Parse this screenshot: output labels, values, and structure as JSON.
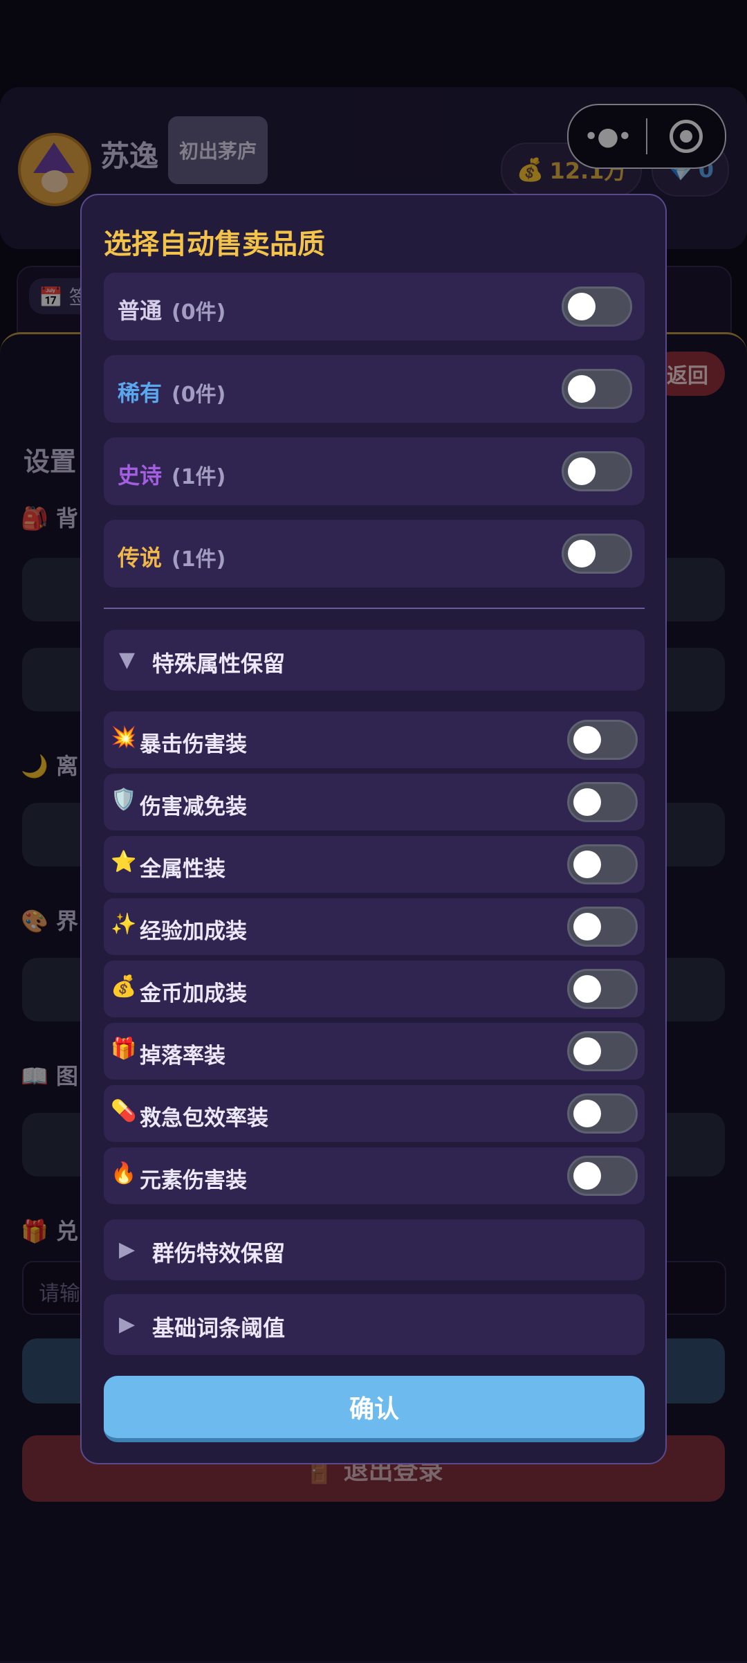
{
  "background": {
    "player_name": "苏逸",
    "rank_badge": "初出茅庐",
    "gold_amount": "12.1万",
    "gem_amount": "0",
    "calendar_chip": "📅 签",
    "back_label": "返回",
    "settings_title": "设置",
    "sections": [
      "🎒 背",
      "🌙 离",
      "🎨 界",
      "📖 图",
      "🎁 兑"
    ],
    "redeem_placeholder": "请输入...",
    "logout_label": "🚪 退出登录"
  },
  "modal": {
    "title": "选择自动售卖品质",
    "qualities": [
      {
        "name": "普通",
        "count": "(0件)",
        "color": "#d6d0ea",
        "enabled": false
      },
      {
        "name": "稀有",
        "count": "(0件)",
        "color": "#5aa7ee",
        "enabled": false
      },
      {
        "name": "史诗",
        "count": "(1件)",
        "color": "#a35fe0",
        "enabled": false
      },
      {
        "name": "传说",
        "count": "(1件)",
        "color": "#f0b84a",
        "enabled": false
      }
    ],
    "special_section": {
      "label": "特殊属性保留",
      "expanded": true
    },
    "attributes": [
      {
        "icon": "💥",
        "icon_name": "explosion-icon",
        "label": "暴击伤害装",
        "enabled": false
      },
      {
        "icon": "🛡️",
        "icon_name": "shield-icon",
        "label": "伤害减免装",
        "enabled": false
      },
      {
        "icon": "⭐",
        "icon_name": "star-icon",
        "label": "全属性装",
        "enabled": false
      },
      {
        "icon": "✨",
        "icon_name": "sparkles-icon",
        "label": "经验加成装",
        "enabled": false
      },
      {
        "icon": "💰",
        "icon_name": "money-bag-icon",
        "label": "金币加成装",
        "enabled": false
      },
      {
        "icon": "🎁",
        "icon_name": "gift-icon",
        "label": "掉落率装",
        "enabled": false
      },
      {
        "icon": "💊",
        "icon_name": "pill-icon",
        "label": "救急包效率装",
        "enabled": false
      },
      {
        "icon": "🔥",
        "icon_name": "fire-icon",
        "label": "元素伤害装",
        "enabled": false
      }
    ],
    "aoe_section": {
      "label": "群伤特效保留",
      "expanded": false
    },
    "base_section": {
      "label": "基础词条阈值",
      "expanded": false
    },
    "confirm_label": "确认"
  },
  "icons": {
    "expanded_triangle": "▼",
    "collapsed_triangle": "▶",
    "gold": "💰",
    "gem": "💎"
  }
}
